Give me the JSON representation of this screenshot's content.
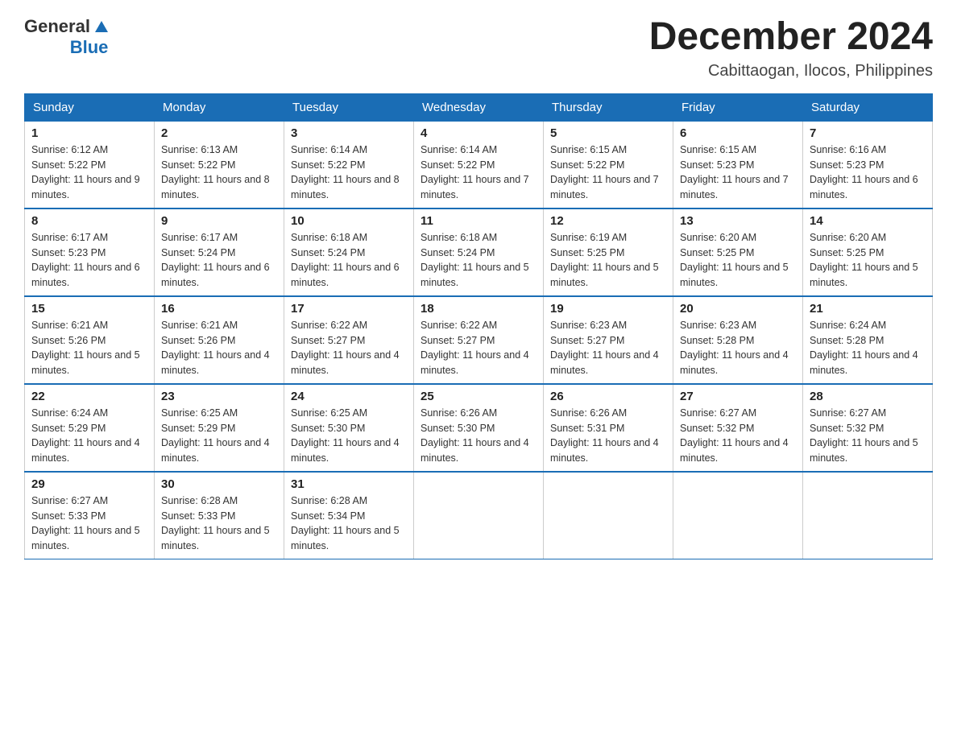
{
  "logo": {
    "general": "General",
    "blue": "Blue"
  },
  "title": {
    "month_year": "December 2024",
    "location": "Cabittaogan, Ilocos, Philippines"
  },
  "headers": [
    "Sunday",
    "Monday",
    "Tuesday",
    "Wednesday",
    "Thursday",
    "Friday",
    "Saturday"
  ],
  "weeks": [
    [
      {
        "day": "1",
        "sunrise": "6:12 AM",
        "sunset": "5:22 PM",
        "daylight": "11 hours and 9 minutes."
      },
      {
        "day": "2",
        "sunrise": "6:13 AM",
        "sunset": "5:22 PM",
        "daylight": "11 hours and 8 minutes."
      },
      {
        "day": "3",
        "sunrise": "6:14 AM",
        "sunset": "5:22 PM",
        "daylight": "11 hours and 8 minutes."
      },
      {
        "day": "4",
        "sunrise": "6:14 AM",
        "sunset": "5:22 PM",
        "daylight": "11 hours and 7 minutes."
      },
      {
        "day": "5",
        "sunrise": "6:15 AM",
        "sunset": "5:22 PM",
        "daylight": "11 hours and 7 minutes."
      },
      {
        "day": "6",
        "sunrise": "6:15 AM",
        "sunset": "5:23 PM",
        "daylight": "11 hours and 7 minutes."
      },
      {
        "day": "7",
        "sunrise": "6:16 AM",
        "sunset": "5:23 PM",
        "daylight": "11 hours and 6 minutes."
      }
    ],
    [
      {
        "day": "8",
        "sunrise": "6:17 AM",
        "sunset": "5:23 PM",
        "daylight": "11 hours and 6 minutes."
      },
      {
        "day": "9",
        "sunrise": "6:17 AM",
        "sunset": "5:24 PM",
        "daylight": "11 hours and 6 minutes."
      },
      {
        "day": "10",
        "sunrise": "6:18 AM",
        "sunset": "5:24 PM",
        "daylight": "11 hours and 6 minutes."
      },
      {
        "day": "11",
        "sunrise": "6:18 AM",
        "sunset": "5:24 PM",
        "daylight": "11 hours and 5 minutes."
      },
      {
        "day": "12",
        "sunrise": "6:19 AM",
        "sunset": "5:25 PM",
        "daylight": "11 hours and 5 minutes."
      },
      {
        "day": "13",
        "sunrise": "6:20 AM",
        "sunset": "5:25 PM",
        "daylight": "11 hours and 5 minutes."
      },
      {
        "day": "14",
        "sunrise": "6:20 AM",
        "sunset": "5:25 PM",
        "daylight": "11 hours and 5 minutes."
      }
    ],
    [
      {
        "day": "15",
        "sunrise": "6:21 AM",
        "sunset": "5:26 PM",
        "daylight": "11 hours and 5 minutes."
      },
      {
        "day": "16",
        "sunrise": "6:21 AM",
        "sunset": "5:26 PM",
        "daylight": "11 hours and 4 minutes."
      },
      {
        "day": "17",
        "sunrise": "6:22 AM",
        "sunset": "5:27 PM",
        "daylight": "11 hours and 4 minutes."
      },
      {
        "day": "18",
        "sunrise": "6:22 AM",
        "sunset": "5:27 PM",
        "daylight": "11 hours and 4 minutes."
      },
      {
        "day": "19",
        "sunrise": "6:23 AM",
        "sunset": "5:27 PM",
        "daylight": "11 hours and 4 minutes."
      },
      {
        "day": "20",
        "sunrise": "6:23 AM",
        "sunset": "5:28 PM",
        "daylight": "11 hours and 4 minutes."
      },
      {
        "day": "21",
        "sunrise": "6:24 AM",
        "sunset": "5:28 PM",
        "daylight": "11 hours and 4 minutes."
      }
    ],
    [
      {
        "day": "22",
        "sunrise": "6:24 AM",
        "sunset": "5:29 PM",
        "daylight": "11 hours and 4 minutes."
      },
      {
        "day": "23",
        "sunrise": "6:25 AM",
        "sunset": "5:29 PM",
        "daylight": "11 hours and 4 minutes."
      },
      {
        "day": "24",
        "sunrise": "6:25 AM",
        "sunset": "5:30 PM",
        "daylight": "11 hours and 4 minutes."
      },
      {
        "day": "25",
        "sunrise": "6:26 AM",
        "sunset": "5:30 PM",
        "daylight": "11 hours and 4 minutes."
      },
      {
        "day": "26",
        "sunrise": "6:26 AM",
        "sunset": "5:31 PM",
        "daylight": "11 hours and 4 minutes."
      },
      {
        "day": "27",
        "sunrise": "6:27 AM",
        "sunset": "5:32 PM",
        "daylight": "11 hours and 4 minutes."
      },
      {
        "day": "28",
        "sunrise": "6:27 AM",
        "sunset": "5:32 PM",
        "daylight": "11 hours and 5 minutes."
      }
    ],
    [
      {
        "day": "29",
        "sunrise": "6:27 AM",
        "sunset": "5:33 PM",
        "daylight": "11 hours and 5 minutes."
      },
      {
        "day": "30",
        "sunrise": "6:28 AM",
        "sunset": "5:33 PM",
        "daylight": "11 hours and 5 minutes."
      },
      {
        "day": "31",
        "sunrise": "6:28 AM",
        "sunset": "5:34 PM",
        "daylight": "11 hours and 5 minutes."
      },
      null,
      null,
      null,
      null
    ]
  ]
}
